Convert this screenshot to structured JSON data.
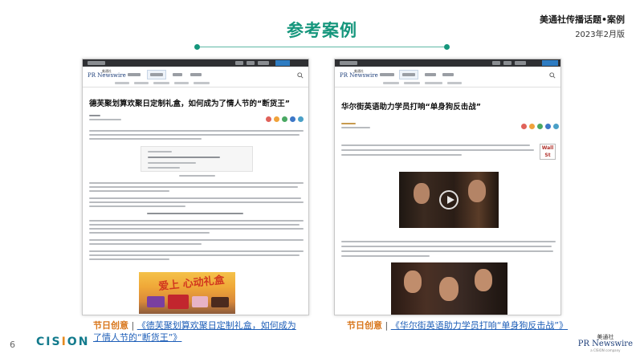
{
  "slide": {
    "title": "参考案例",
    "brand_line1": "美通社传播话题•案例",
    "brand_line2": "2023年2月版",
    "page_number": "6",
    "accent_color": "#15967c",
    "label_color": "#d8761b",
    "link_color": "#1f5fb8"
  },
  "footer": {
    "cision_logo_text": [
      "C",
      "IS",
      "I",
      "ON"
    ],
    "prn_logo_cn": "美通社",
    "prn_logo_en": "PR Newswire",
    "prn_logo_sub": "a CISION company"
  },
  "cases": [
    {
      "headline": "德芙聚划算欢聚日定制礼盒，如何成为了情人节的“断货王”",
      "caption_label": "节日创意",
      "caption_sep": "|",
      "caption_link": "《德芙聚划算欢聚日定制礼盒，如何成为了情人节的“断货王”》",
      "screenshot_logo_cn": "美通社",
      "screenshot_logo_en": "PR Newswire",
      "promo_text": "爱上 心动礼盒"
    },
    {
      "headline": "华尔街英语助力学员打响“单身狗反击战”",
      "caption_label": "节日创意",
      "caption_sep": "|",
      "caption_link": "《华尔街英语助力学员打响“单身狗反击战”》",
      "screenshot_logo_cn": "美通社",
      "screenshot_logo_en": "PR Newswire",
      "tag_logo_text": "Wall St"
    }
  ]
}
